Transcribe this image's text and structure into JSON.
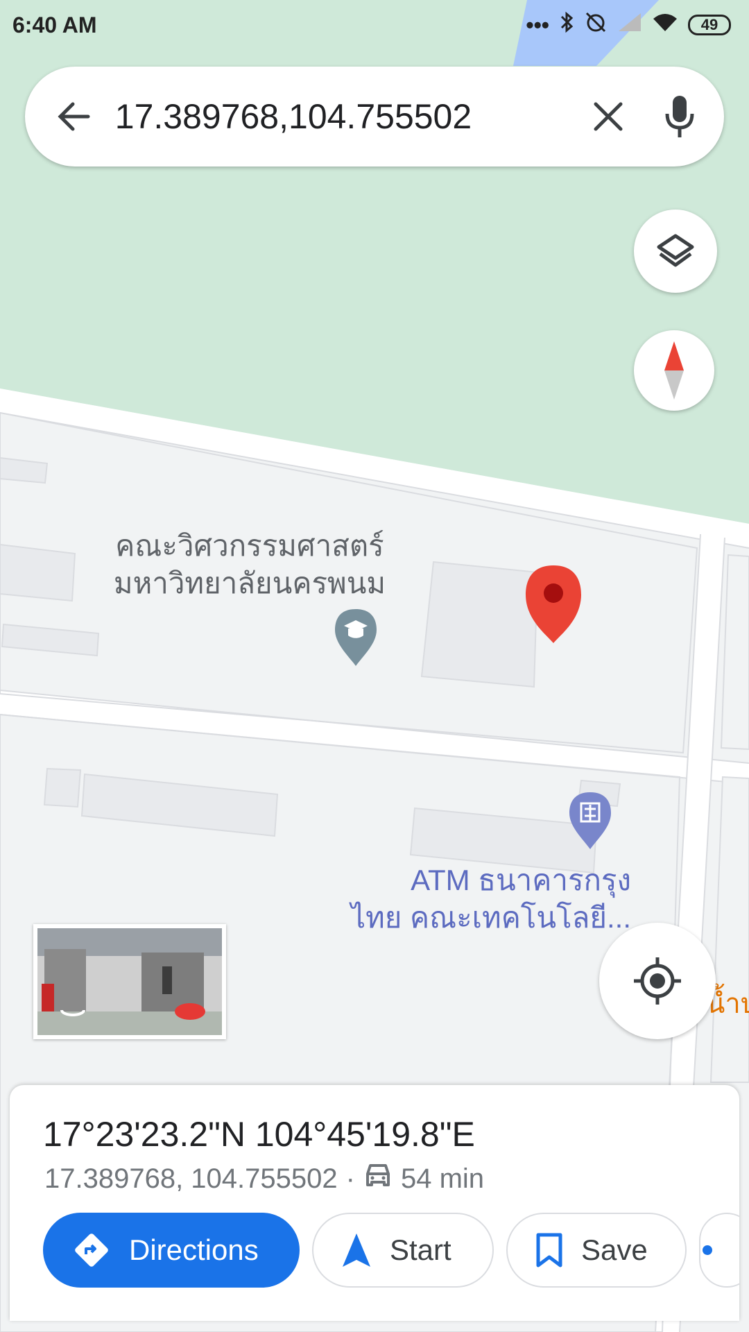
{
  "status_bar": {
    "time": "6:40 AM",
    "battery": "49",
    "icons": [
      "dots-icon",
      "bluetooth-icon",
      "alarm-off-icon",
      "signal-icon",
      "wifi-icon",
      "battery-icon"
    ]
  },
  "search": {
    "value": "17.389768,104.755502",
    "back_icon": "arrow-back-icon",
    "clear_icon": "close-icon",
    "mic_icon": "mic-icon"
  },
  "map": {
    "labels": {
      "faculty_line1": "คณะวิศวกรรมศาสตร์",
      "faculty_line2": "มหาวิทยาลัยนครพนม",
      "atm_line1": "ATM ธนาคารกรุง",
      "atm_line2": "ไทย คณะเทคโนโลยี...",
      "water": "น้ำบ"
    },
    "colors": {
      "park": "#cfe9d9",
      "land": "#f1f3f4",
      "road": "#ffffff",
      "pin": "#ea4335",
      "bank_poi": "#7986cb",
      "school_poi": "#78909c",
      "water_label": "#e37400"
    }
  },
  "place_sheet": {
    "title": "17°23'23.2\"N 104°45'19.8\"E",
    "coords": "17.389768, 104.755502",
    "separator": "·",
    "drive_time": "54 min",
    "actions": {
      "directions": "Directions",
      "start": "Start",
      "save": "Save"
    },
    "accent": "#1a73e8"
  }
}
